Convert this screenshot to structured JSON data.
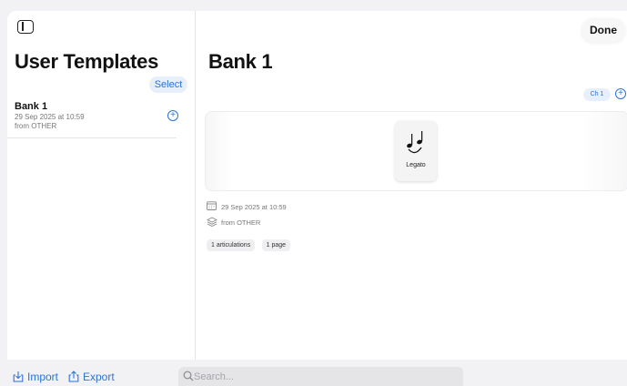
{
  "sidebar": {
    "title": "User Templates",
    "select_label": "Select",
    "items": [
      {
        "name": "Bank 1",
        "date": "29 Sep 2025 at 10:59",
        "source": "from OTHER"
      }
    ]
  },
  "main": {
    "done_label": "Done",
    "title": "Bank 1",
    "channel_label": "Ch 1",
    "articulations": [
      {
        "label": "Legato",
        "icon": "legato-notes-icon"
      }
    ],
    "meta": {
      "date": "29 Sep 2025 at 10:59",
      "source": "from OTHER"
    },
    "tags": [
      "1 articulations",
      "1 page"
    ]
  },
  "bottom": {
    "import_label": "Import",
    "export_label": "Export",
    "search_placeholder": "Search..."
  },
  "colors": {
    "accent": "#2b73d9",
    "accent_bg": "#e6effa"
  }
}
